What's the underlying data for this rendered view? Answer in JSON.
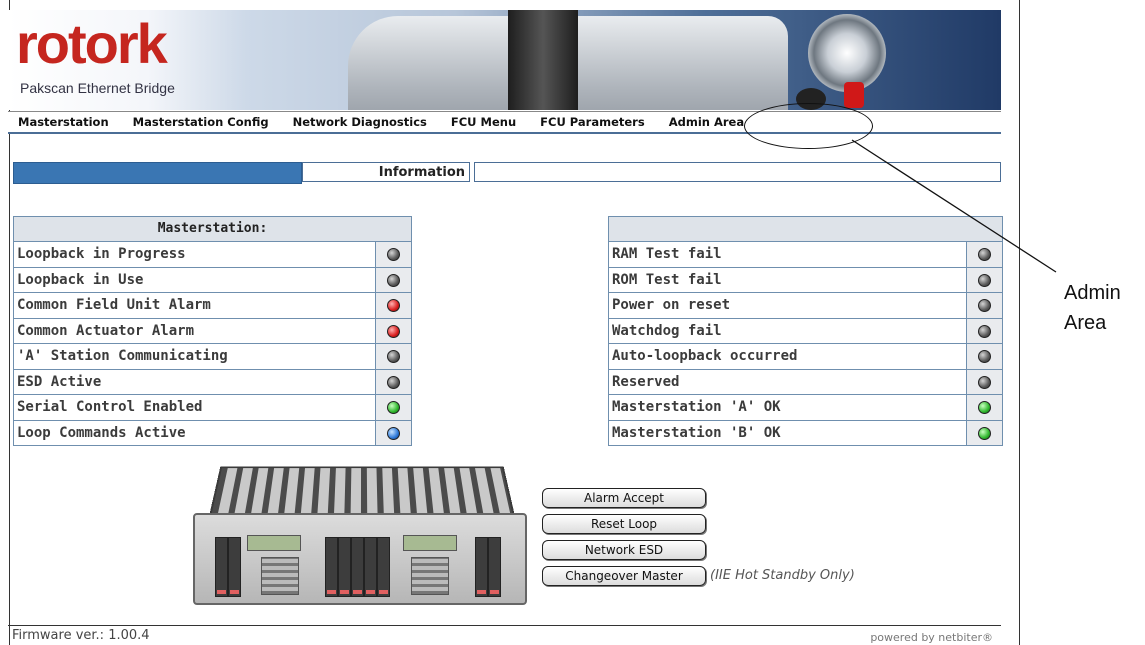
{
  "brand": {
    "logo_text": "rotork",
    "subtitle": "Pakscan Ethernet Bridge"
  },
  "nav": {
    "items": [
      {
        "label": "Masterstation"
      },
      {
        "label": "Masterstation Config"
      },
      {
        "label": "Network Diagnostics"
      },
      {
        "label": "FCU Menu"
      },
      {
        "label": "FCU Parameters"
      },
      {
        "label": "Admin Area"
      }
    ]
  },
  "info_bar": {
    "label": "Information",
    "value": ""
  },
  "left_panel": {
    "title": "Masterstation:",
    "rows": [
      {
        "label": "Loopback in Progress",
        "led": "off"
      },
      {
        "label": "Loopback in Use",
        "led": "off"
      },
      {
        "label": "Common Field Unit Alarm",
        "led": "red"
      },
      {
        "label": "Common Actuator Alarm",
        "led": "red"
      },
      {
        "label": "'A' Station Communicating",
        "led": "off"
      },
      {
        "label": "ESD Active",
        "led": "off"
      },
      {
        "label": "Serial Control Enabled",
        "led": "green"
      },
      {
        "label": "Loop Commands Active",
        "led": "blue"
      }
    ]
  },
  "right_panel": {
    "title": "",
    "rows": [
      {
        "label": "RAM Test fail",
        "led": "off"
      },
      {
        "label": "ROM Test fail",
        "led": "off"
      },
      {
        "label": "Power on reset",
        "led": "off"
      },
      {
        "label": "Watchdog fail",
        "led": "off"
      },
      {
        "label": "Auto-loopback occurred",
        "led": "off"
      },
      {
        "label": "Reserved",
        "led": "off"
      },
      {
        "label": "Masterstation 'A' OK",
        "led": "green"
      },
      {
        "label": "Masterstation 'B' OK",
        "led": "green"
      }
    ]
  },
  "buttons": {
    "alarm_accept": "Alarm Accept",
    "reset_loop": "Reset Loop",
    "network_esd": "Network ESD",
    "changeover_master": "Changeover Master",
    "hot_standby_note": "(IIE Hot Standby Only)"
  },
  "footer": {
    "firmware": "Firmware ver.: 1.00.4",
    "powered_by": "powered by netbiter®"
  },
  "annotation": {
    "line1": "Admin",
    "line2": "Area"
  },
  "colors": {
    "brand_red": "#c5261f",
    "header_blue": "#3a76b3",
    "panel_border": "#6f8fae",
    "panel_head": "#dee3e9"
  }
}
